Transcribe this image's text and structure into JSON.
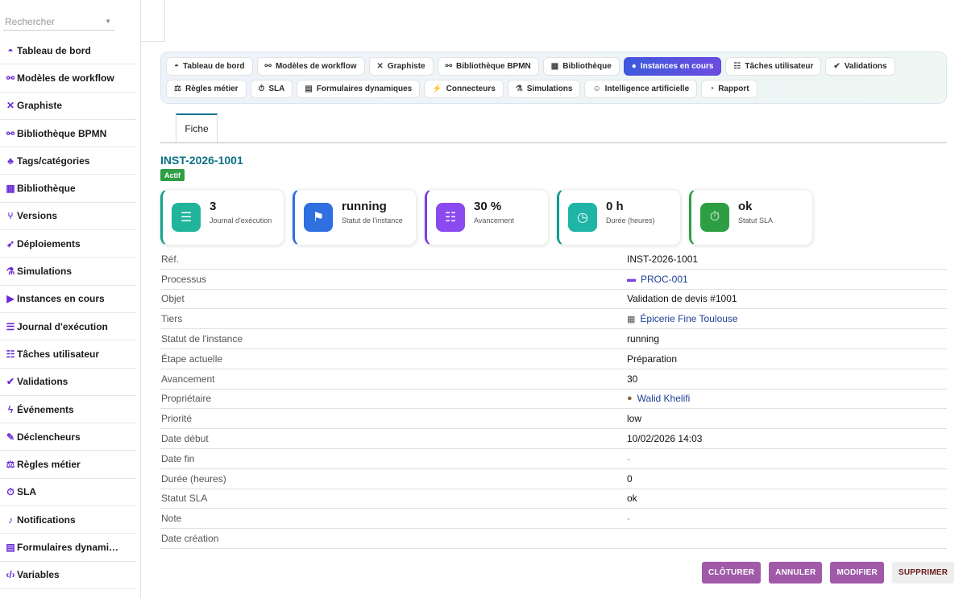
{
  "sidebar": {
    "search_placeholder": "Rechercher",
    "items": [
      {
        "icon": "dashboard-icon",
        "glyph": "◓",
        "label": "Tableau de bord"
      },
      {
        "icon": "workflow-icon",
        "glyph": "⚯",
        "label": "Modèles de workflow"
      },
      {
        "icon": "designer-icon",
        "glyph": "✕",
        "label": "Graphiste"
      },
      {
        "icon": "bpmn-icon",
        "glyph": "⚯",
        "label": "Bibliothèque BPMN"
      },
      {
        "icon": "tags-icon",
        "glyph": "♣",
        "label": "Tags/catégories"
      },
      {
        "icon": "library-icon",
        "glyph": "▦",
        "label": "Bibliothèque"
      },
      {
        "icon": "versions-icon",
        "glyph": "⑂",
        "label": "Versions"
      },
      {
        "icon": "deploy-icon",
        "glyph": "➶",
        "label": "Déploiements"
      },
      {
        "icon": "flask-icon",
        "glyph": "⚗",
        "label": "Simulations"
      },
      {
        "icon": "play-icon",
        "glyph": "▶",
        "label": "Instances en cours"
      },
      {
        "icon": "log-icon",
        "glyph": "☰",
        "label": "Journal d'exécution"
      },
      {
        "icon": "tasks-icon",
        "glyph": "☷",
        "label": "Tâches utilisateur"
      },
      {
        "icon": "check-icon",
        "glyph": "✔",
        "label": "Validations"
      },
      {
        "icon": "bolt-icon",
        "glyph": "ϟ",
        "label": "Événements"
      },
      {
        "icon": "trigger-icon",
        "glyph": "✎",
        "label": "Déclencheurs"
      },
      {
        "icon": "scale-icon",
        "glyph": "⚖",
        "label": "Règles métier"
      },
      {
        "icon": "timer-icon",
        "glyph": "⏱",
        "label": "SLA"
      },
      {
        "icon": "bell-icon",
        "glyph": "♪",
        "label": "Notifications"
      },
      {
        "icon": "form-icon",
        "glyph": "▤",
        "label": "Formulaires dynami…"
      },
      {
        "icon": "code-icon",
        "glyph": "‹/›",
        "label": "Variables"
      }
    ]
  },
  "tabs_row1": [
    {
      "icon": "dashboard-icon",
      "glyph": "◓",
      "label": "Tableau de bord",
      "active": false
    },
    {
      "icon": "workflow-icon",
      "glyph": "⚯",
      "label": "Modèles de workflow",
      "active": false
    },
    {
      "icon": "designer-icon",
      "glyph": "✕",
      "label": "Graphiste",
      "active": false
    },
    {
      "icon": "bpmn-icon",
      "glyph": "⚯",
      "label": "Bibliothèque BPMN",
      "active": false
    },
    {
      "icon": "library-icon",
      "glyph": "▦",
      "label": "Bibliothèque",
      "active": false
    },
    {
      "icon": "play-icon",
      "glyph": "●",
      "label": "Instances en cours",
      "active": true
    },
    {
      "icon": "tasks-icon",
      "glyph": "☷",
      "label": "Tâches utilisateur",
      "active": false
    },
    {
      "icon": "check-icon",
      "glyph": "✔",
      "label": "Validations",
      "active": false
    }
  ],
  "tabs_row2": [
    {
      "icon": "scale-icon",
      "glyph": "⚖",
      "label": "Règles métier",
      "active": false
    },
    {
      "icon": "timer-icon",
      "glyph": "⏱",
      "label": "SLA",
      "active": false
    },
    {
      "icon": "form-icon",
      "glyph": "▤",
      "label": "Formulaires dynamiques",
      "active": false
    },
    {
      "icon": "plug-icon",
      "glyph": "⚡",
      "label": "Connecteurs",
      "active": false
    },
    {
      "icon": "flask-icon",
      "glyph": "⚗",
      "label": "Simulations",
      "active": false
    },
    {
      "icon": "robot-icon",
      "glyph": "☺",
      "label": "Intelligence artificielle",
      "active": false
    },
    {
      "icon": "chart-pie-icon",
      "glyph": "◔",
      "label": "Rapport",
      "active": false
    }
  ],
  "record": {
    "tab_label": "Fiche",
    "title": "INST-2026-1001",
    "status_badge": "Actif"
  },
  "kpis": [
    {
      "icon": "list-icon",
      "glyph": "☰",
      "value": "3",
      "label": "Journal d'exécution",
      "accent": "#14a38b",
      "bg": "#20b49a"
    },
    {
      "icon": "flag-icon",
      "glyph": "⚑",
      "value": "running",
      "label": "Statut de l'instance",
      "accent": "#2f6fe0",
      "bg": "#2f6fe0"
    },
    {
      "icon": "checklist-icon",
      "glyph": "☷",
      "value": "30 %",
      "label": "Avancement",
      "accent": "#7b3fe4",
      "bg": "#8a4af0"
    },
    {
      "icon": "clock-icon",
      "glyph": "◷",
      "value": "0 h",
      "label": "Durée (heures)",
      "accent": "#139a8f",
      "bg": "#1fb5a6"
    },
    {
      "icon": "stopwatch-icon",
      "glyph": "⏱",
      "value": "ok",
      "label": "Statut SLA",
      "accent": "#2e9e44",
      "bg": "#2e9e44"
    }
  ],
  "details": [
    {
      "label": "Réf.",
      "value": "INST-2026-1001",
      "kind": "text"
    },
    {
      "label": "Processus",
      "value": "PROC-001",
      "kind": "link",
      "icon": "process-icon",
      "glyph": "▬",
      "icon_color": "#7b3fe4"
    },
    {
      "label": "Objet",
      "value": "Validation de devis #1001",
      "kind": "text"
    },
    {
      "label": "Tiers",
      "value": "Épicerie Fine Toulouse",
      "kind": "link",
      "icon": "building-icon",
      "glyph": "▦",
      "icon_color": "#555"
    },
    {
      "label": "Statut de l'instance",
      "value": "running",
      "kind": "text"
    },
    {
      "label": "Étape actuelle",
      "value": "Préparation",
      "kind": "text"
    },
    {
      "label": "Avancement",
      "value": "30",
      "kind": "text"
    },
    {
      "label": "Propriétaire",
      "value": "Walid Khelifi",
      "kind": "link",
      "icon": "user-icon",
      "glyph": "●",
      "icon_color": "#8a6a3a"
    },
    {
      "label": "Priorité",
      "value": "low",
      "kind": "text"
    },
    {
      "label": "Date début",
      "value": "10/02/2026 14:03",
      "kind": "text"
    },
    {
      "label": "Date fin",
      "value": "-",
      "kind": "muted"
    },
    {
      "label": "Durée (heures)",
      "value": "0",
      "kind": "text"
    },
    {
      "label": "Statut SLA",
      "value": "ok",
      "kind": "text"
    },
    {
      "label": "Note",
      "value": "-",
      "kind": "muted"
    },
    {
      "label": "Date création",
      "value": "",
      "kind": "text"
    }
  ],
  "actions": [
    {
      "name": "close-button",
      "label": "CLÔTURER",
      "style": "primary"
    },
    {
      "name": "cancel-button",
      "label": "ANNULER",
      "style": "primary"
    },
    {
      "name": "edit-button",
      "label": "MODIFIER",
      "style": "primary"
    },
    {
      "name": "delete-button",
      "label": "SUPPRIMER",
      "style": "del"
    }
  ]
}
